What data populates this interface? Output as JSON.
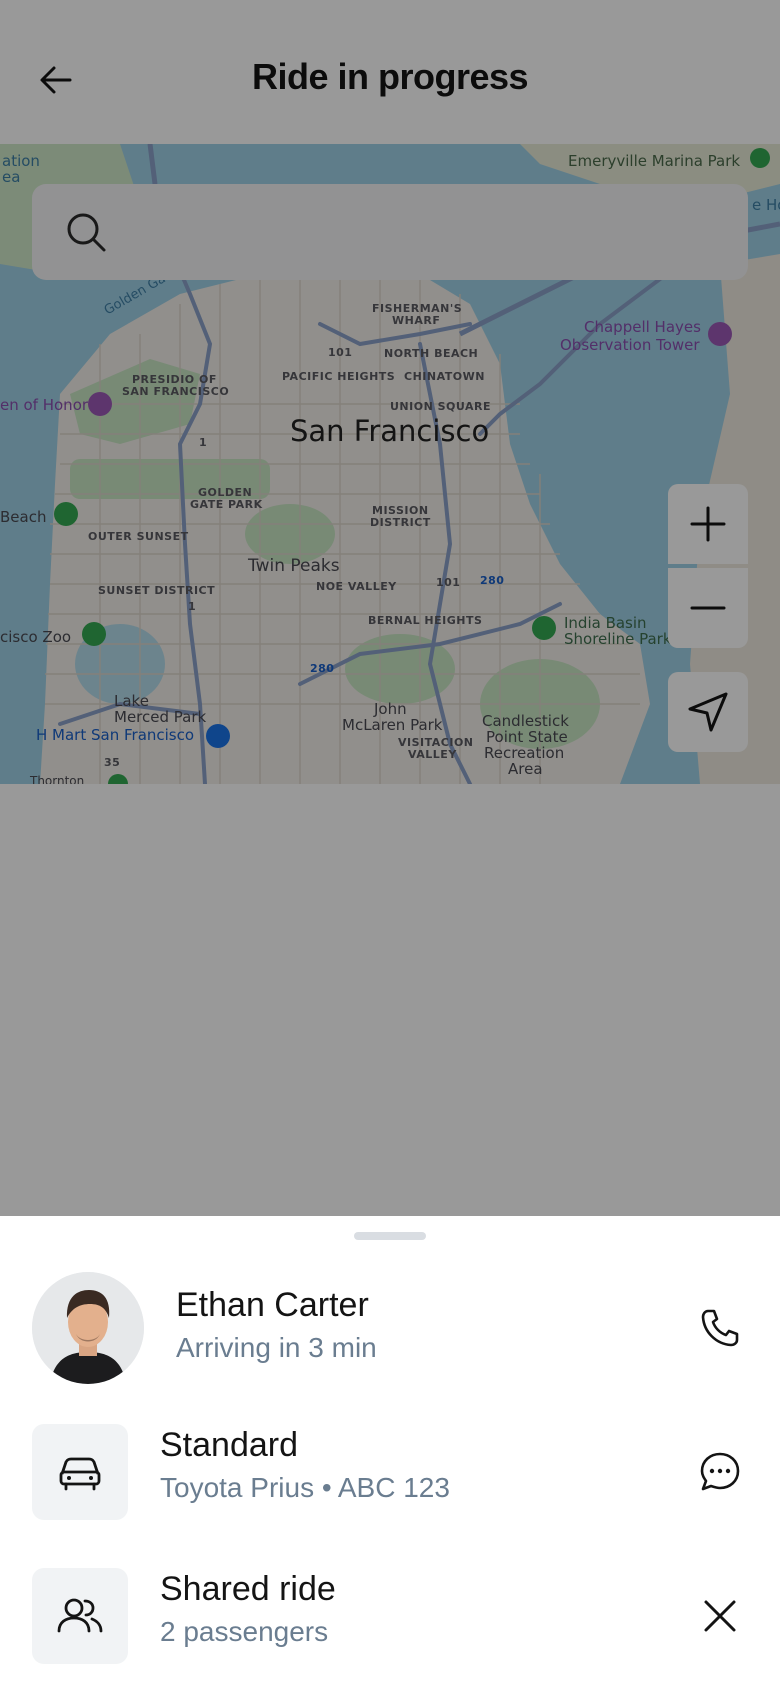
{
  "header": {
    "title": "Ride in progress",
    "back_icon": "arrow-left-icon"
  },
  "search": {
    "placeholder": "",
    "icon": "search-icon"
  },
  "map": {
    "city_label": "San Francisco",
    "labels": {
      "emeryville": "Emeryville Marina Park",
      "golden_gate": "Golden Gate",
      "fishermans_wharf_1": "FISHERMAN'S",
      "fishermans_wharf_2": "WHARF",
      "north_beach": "NORTH BEACH",
      "chinatown": "CHINATOWN",
      "pacific_heights": "PACIFIC HEIGHTS",
      "presidio_1": "PRESIDIO OF",
      "presidio_2": "SAN FRANCISCO",
      "union_square": "UNION SQUARE",
      "legion": "en of Honor",
      "chappell_1": "Chappell Hayes",
      "chappell_2": "Observation Tower",
      "golden_gate_park_1": "GOLDEN",
      "golden_gate_park_2": "GATE PARK",
      "mission_1": "MISSION",
      "mission_2": "DISTRICT",
      "beach": "Beach",
      "outer_sunset": "OUTER SUNSET",
      "twin_peaks": "Twin Peaks",
      "noe_valley": "NOE VALLEY",
      "sunset_district": "SUNSET DISTRICT",
      "bernal": "BERNAL HEIGHTS",
      "india_basin_1": "India Basin",
      "india_basin_2": "Shoreline Park",
      "zoo": "cisco Zoo",
      "lake_merced_1": "Lake",
      "lake_merced_2": "Merced Park",
      "hmart": "H Mart San Francisco",
      "john_mclaren_1": "John",
      "john_mclaren_2": "McLaren Park",
      "visitacion_1": "VISITACION",
      "visitacion_2": "VALLEY",
      "candlestick_1": "Candlestick",
      "candlestick_2": "Point State",
      "candlestick_3": "Recreation",
      "candlestick_4": "Area",
      "ation": "ation",
      "ea": "ea",
      "e_ho": "e Ho",
      "thornton": "Thornton",
      "shield_101a": "101",
      "shield_101b": "101",
      "shield_1a": "1",
      "shield_1b": "1",
      "shield_280a": "280",
      "shield_280b": "280",
      "shield_35": "35"
    },
    "controls": {
      "zoom_in_icon": "plus-icon",
      "zoom_out_icon": "minus-icon",
      "locate_icon": "navigation-arrow-icon"
    }
  },
  "driver": {
    "name": "Ethan Carter",
    "status": "Arriving in 3 min",
    "action_icon": "phone-icon"
  },
  "vehicle": {
    "title": "Standard",
    "detail": "Toyota Prius • ABC 123",
    "icon": "car-icon",
    "action_icon": "chat-bubble-icon"
  },
  "shared": {
    "title": "Shared ride",
    "detail": "2 passengers",
    "icon": "users-icon",
    "action_icon": "close-icon"
  },
  "colors": {
    "water": "#9fd0e6",
    "land": "#f2efe9",
    "park": "#c8e6c4",
    "road": "#8aa0c8",
    "overlay": "rgba(0,0,0,0.40)",
    "subtext": "#6a7d90"
  }
}
